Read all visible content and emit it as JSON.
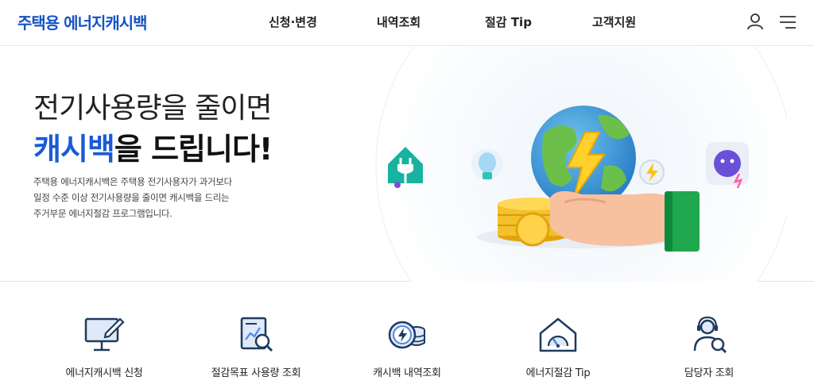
{
  "header": {
    "logo": "주택용 에너지캐시백",
    "nav": [
      {
        "label": "신청·변경"
      },
      {
        "label": "내역조회"
      },
      {
        "label": "절감 Tip"
      },
      {
        "label": "고객지원"
      }
    ],
    "user_icon": "user-icon",
    "menu_icon": "hamburger-menu-icon"
  },
  "hero": {
    "title_line1": "전기사용량을 줄이면",
    "title_highlight": "캐시백",
    "title_rest": "을 드립니다!",
    "desc": [
      "주택용 에너지캐시백은 주택용 전기사용자가 과거보다",
      "일정 수준 이상 전기사용량을 줄이면 캐시백을 드리는",
      "주거부문 에너지절감 프로그램입니다."
    ]
  },
  "quick_menu": [
    {
      "label": "에너지캐시백 신청",
      "icon": "monitor-pen-icon"
    },
    {
      "label": "절감목표 사용량 조회",
      "icon": "document-search-icon"
    },
    {
      "label": "캐시백 내역조회",
      "icon": "coin-lightning-icon"
    },
    {
      "label": "에너지절감 Tip",
      "icon": "house-gauge-icon"
    },
    {
      "label": "담당자 조회",
      "icon": "person-headset-icon"
    }
  ],
  "colors": {
    "brand": "#1453c4",
    "highlight": "#1a5ad6",
    "icon_navy": "#1f3a5f",
    "icon_accent": "#4a86e8"
  }
}
